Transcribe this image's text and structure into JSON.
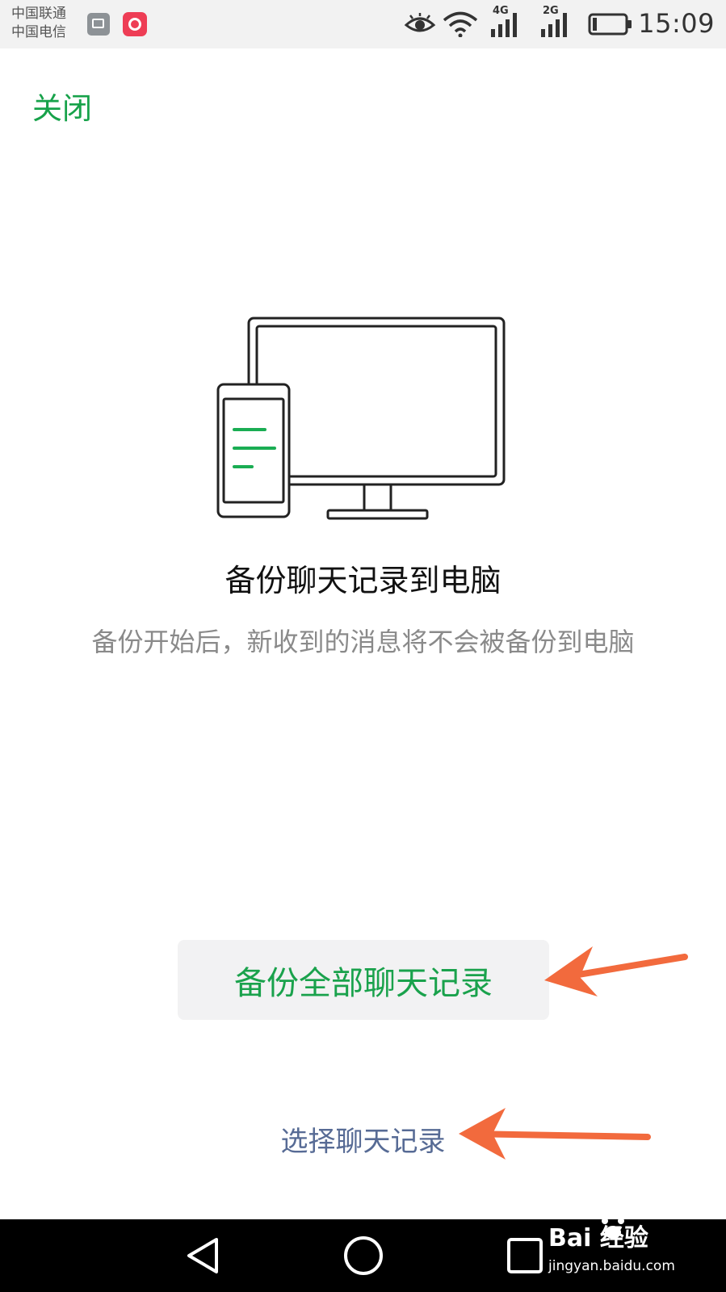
{
  "status_bar": {
    "carrier_1": "中国联通",
    "carrier_2": "中国电信",
    "network_1": "4G",
    "network_2": "2G",
    "time": "15:09",
    "icons": [
      "gallery-icon",
      "app-icon",
      "eye-icon",
      "wifi-icon",
      "signal-icon",
      "signal-icon",
      "battery-icon"
    ]
  },
  "header": {
    "close_label": "关闭"
  },
  "main": {
    "title": "备份聊天记录到电脑",
    "subtitle": "备份开始后，新收到的消息将不会被备份到电脑",
    "illustration_icon": "phone-and-monitor-icon"
  },
  "actions": {
    "backup_all_label": "备份全部聊天记录",
    "select_label": "选择聊天记录"
  },
  "annotations": {
    "arrow_color": "#f26a3d"
  },
  "navigation": {
    "icons": [
      "back-icon",
      "home-icon",
      "recents-icon"
    ]
  },
  "watermark": {
    "title": "Bai  经验",
    "url": "jingyan.baidu.com"
  },
  "colors": {
    "accent_green": "#1aa24c",
    "link_blue": "#576b95",
    "subtitle_gray": "#8a8a8a"
  }
}
